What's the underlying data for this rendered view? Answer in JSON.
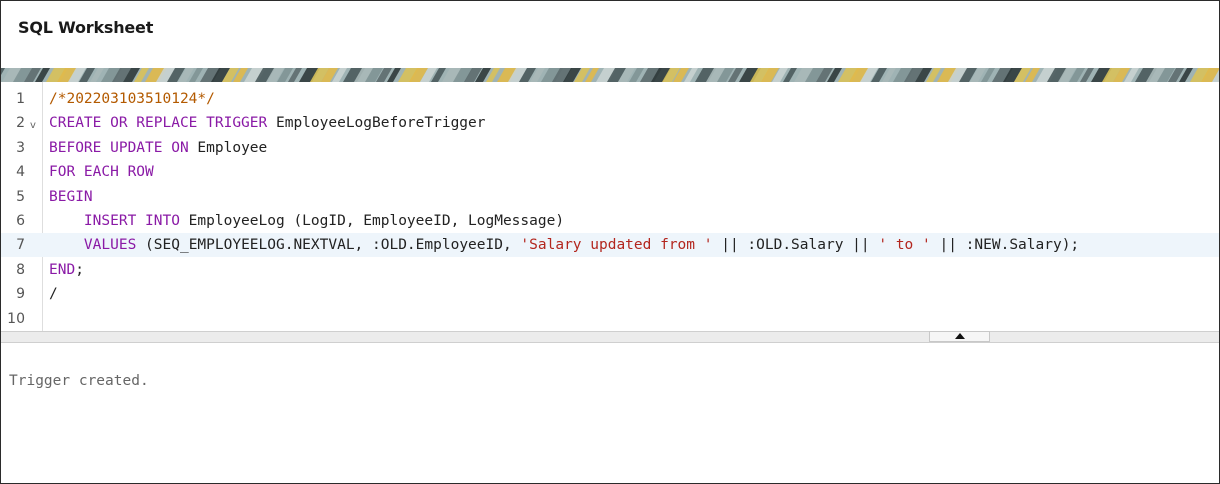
{
  "worksheet": {
    "title": "SQL Worksheet"
  },
  "editor": {
    "active_line": 7,
    "lines": [
      {
        "number": "1",
        "fold": "",
        "tokens": [
          {
            "t": "/*202203103510124*/",
            "c": "cm"
          }
        ]
      },
      {
        "number": "2",
        "fold": "v",
        "tokens": [
          {
            "t": "CREATE OR REPLACE TRIGGER",
            "c": "kw"
          },
          {
            "t": " EmployeeLogBeforeTrigger",
            "c": ""
          }
        ]
      },
      {
        "number": "3",
        "fold": "",
        "tokens": [
          {
            "t": "BEFORE UPDATE ON",
            "c": "kw"
          },
          {
            "t": " Employee",
            "c": ""
          }
        ]
      },
      {
        "number": "4",
        "fold": "",
        "tokens": [
          {
            "t": "FOR EACH ROW",
            "c": "kw"
          }
        ]
      },
      {
        "number": "5",
        "fold": "",
        "tokens": [
          {
            "t": "BEGIN",
            "c": "kw"
          }
        ]
      },
      {
        "number": "6",
        "fold": "",
        "tokens": [
          {
            "t": "    ",
            "c": ""
          },
          {
            "t": "INSERT INTO",
            "c": "kw"
          },
          {
            "t": " EmployeeLog (LogID, EmployeeID, LogMessage)",
            "c": ""
          }
        ]
      },
      {
        "number": "7",
        "fold": "",
        "tokens": [
          {
            "t": "    ",
            "c": ""
          },
          {
            "t": "VALUES",
            "c": "kw"
          },
          {
            "t": " (SEQ_EMPLOYEELOG.NEXTVAL, :OLD.EmployeeID, ",
            "c": ""
          },
          {
            "t": "'Salary updated from '",
            "c": "st"
          },
          {
            "t": " || :OLD.Salary || ",
            "c": ""
          },
          {
            "t": "' to '",
            "c": "st"
          },
          {
            "t": " || :NEW.Salary);",
            "c": ""
          }
        ]
      },
      {
        "number": "8",
        "fold": "",
        "tokens": [
          {
            "t": "END",
            "c": "kw"
          },
          {
            "t": ";",
            "c": ""
          }
        ]
      },
      {
        "number": "9",
        "fold": "",
        "tokens": [
          {
            "t": "/",
            "c": ""
          }
        ]
      },
      {
        "number": "10",
        "fold": "",
        "tokens": []
      }
    ]
  },
  "output": {
    "message": "Trigger created."
  },
  "colors": {
    "keyword": "#8a1aa6",
    "comment": "#b35a00",
    "string": "#b3261e",
    "active_line": "#eef5fb"
  }
}
